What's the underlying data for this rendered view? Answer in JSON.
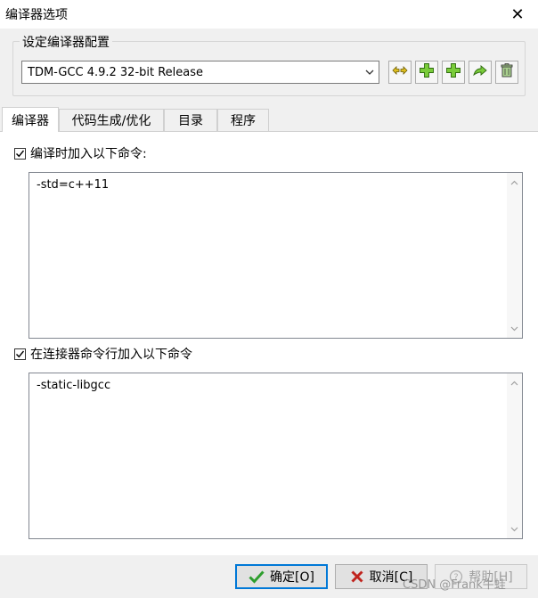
{
  "window": {
    "title": "编译器选项",
    "close_glyph": "✕"
  },
  "compiler_config": {
    "group_label": "设定编译器配置",
    "selected": "TDM-GCC 4.9.2 32-bit Release",
    "tools": [
      "swap-icon",
      "add-icon",
      "add-icon",
      "rename-icon",
      "delete-icon"
    ]
  },
  "tabs": [
    {
      "label": "编译器",
      "active": true
    },
    {
      "label": "代码生成/优化",
      "active": false
    },
    {
      "label": "目录",
      "active": false
    },
    {
      "label": "程序",
      "active": false
    }
  ],
  "compile_cmd": {
    "label": "编译时加入以下命令:",
    "checked": true,
    "value": "-std=c++11"
  },
  "linker_cmd": {
    "label": "在连接器命令行加入以下命令",
    "checked": true,
    "value": "-static-libgcc"
  },
  "footer": {
    "ok_label": "确定[O]",
    "cancel_label": "取消[C]",
    "help_label": "帮助[H]"
  },
  "watermark": "CSDN @Frank牛蛙",
  "colors": {
    "accent": "#0078d7",
    "ok_green": "#2e9e2e",
    "cancel_red": "#c0241e"
  }
}
